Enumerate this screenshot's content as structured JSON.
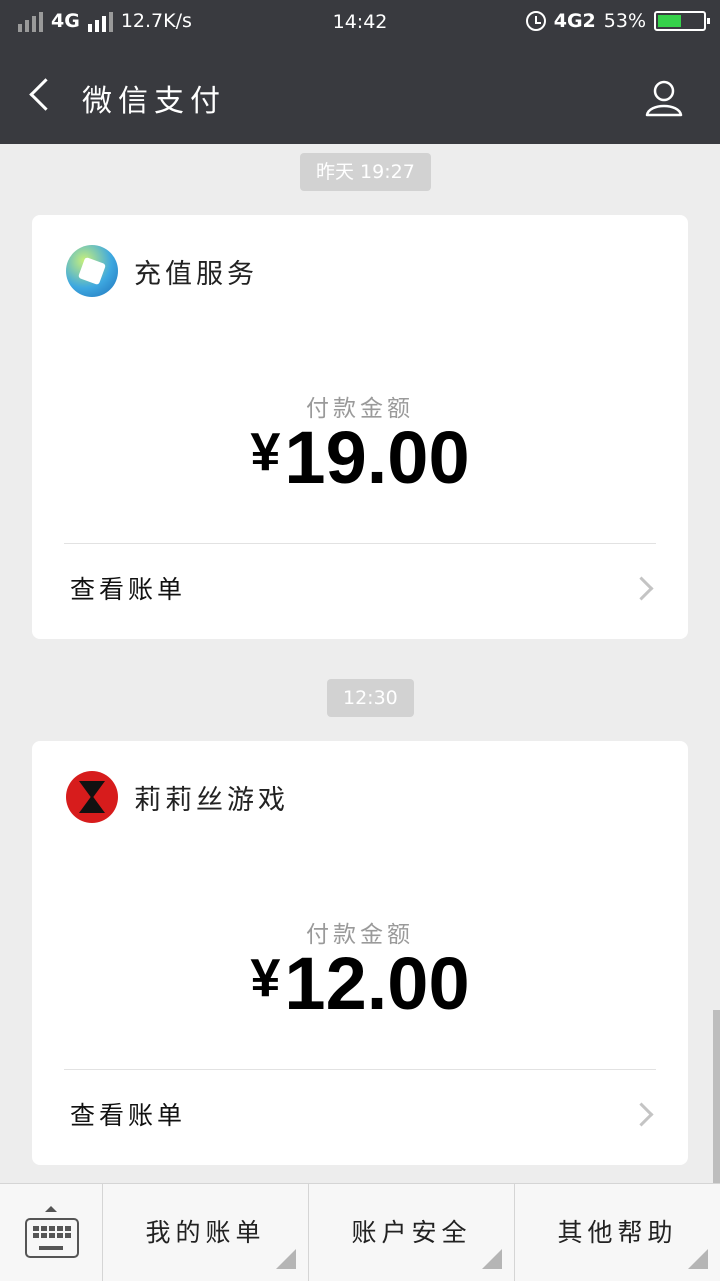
{
  "status_bar": {
    "network_type": "4G",
    "speed": "12.7K/s",
    "time": "14:42",
    "network_type_2": "4G2",
    "battery": "53%",
    "battery_level": 0.53
  },
  "header": {
    "title": "微信支付"
  },
  "messages": [
    {
      "time": "昨天 19:27",
      "merchant": "充值服务",
      "amount_label": "付款金额",
      "currency": "¥",
      "amount": "19.00",
      "view_bill": "查看账单"
    },
    {
      "time": "12:30",
      "merchant": "莉莉丝游戏",
      "amount_label": "付款金额",
      "currency": "¥",
      "amount": "12.00",
      "view_bill": "查看账单"
    }
  ],
  "bottom_menu": {
    "items": [
      "我的账单",
      "账户安全",
      "其他帮助"
    ]
  },
  "colors": {
    "header_bg": "#393a3f",
    "page_bg": "#ededed",
    "card_bg": "#ffffff"
  },
  "icons": [
    "back-icon",
    "user-icon",
    "keyboard-icon",
    "chevron-right-icon",
    "alarm-icon",
    "battery-icon"
  ]
}
